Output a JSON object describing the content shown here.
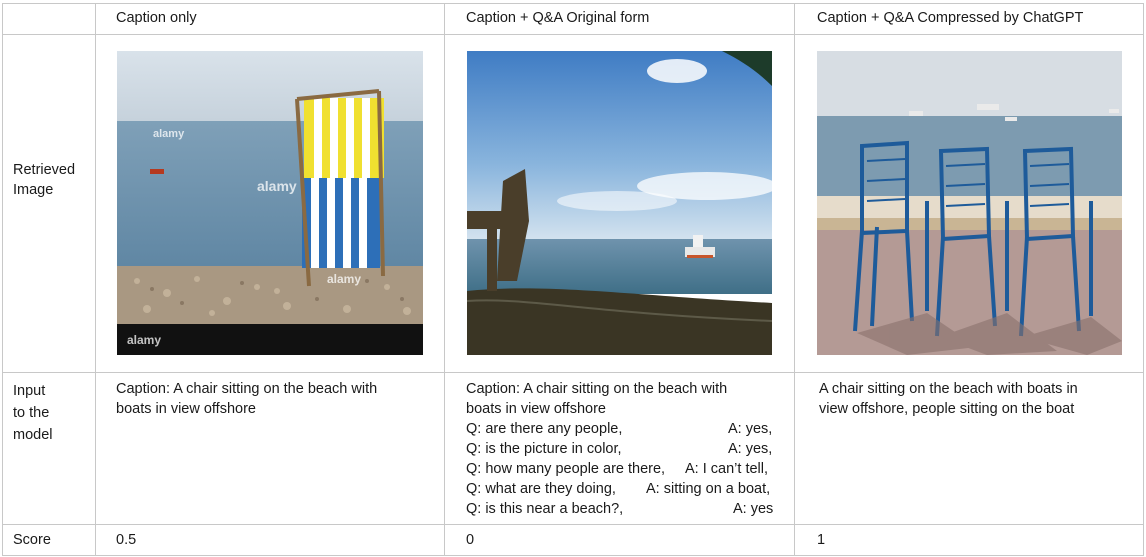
{
  "table": {
    "headers": [
      "",
      "Caption only",
      "Caption + Q&A Original form",
      "Caption + Q&A Compressed by ChatGPT"
    ],
    "row_labels": {
      "retrieved_image": [
        "Retrieved",
        "Image"
      ],
      "input": [
        "Input",
        "to the",
        "model"
      ],
      "score": "Score"
    },
    "inputs": {
      "caption_only": [
        "Caption: A chair sitting on the beach with",
        "boats in view offshore"
      ],
      "original_caption": [
        "Caption: A chair sitting on the beach with",
        "boats in view offshore"
      ],
      "original_qa": [
        {
          "q": "Q: are there any people,",
          "a": "A: yes,"
        },
        {
          "q": "Q: is the picture in color,",
          "a": "A: yes,"
        },
        {
          "q": "Q: how many people are there,",
          "a": "A: I can’t tell,"
        },
        {
          "q": "Q: what are they doing,",
          "a": "A: sitting on a boat,"
        },
        {
          "q": "Q: is this near a beach?,",
          "a": "A: yes"
        }
      ],
      "compressed": [
        "A chair sitting on the beach with boats in",
        "view offshore, people sitting on the boat"
      ]
    },
    "scores": [
      "0.5",
      "0",
      "1"
    ]
  },
  "images": {
    "image1": {
      "watermark": "alamy",
      "description_icon": "beach-chair-photo"
    },
    "image2": {
      "description_icon": "beach-boat-photo"
    },
    "image3": {
      "description_icon": "blue-chairs-photo"
    }
  }
}
